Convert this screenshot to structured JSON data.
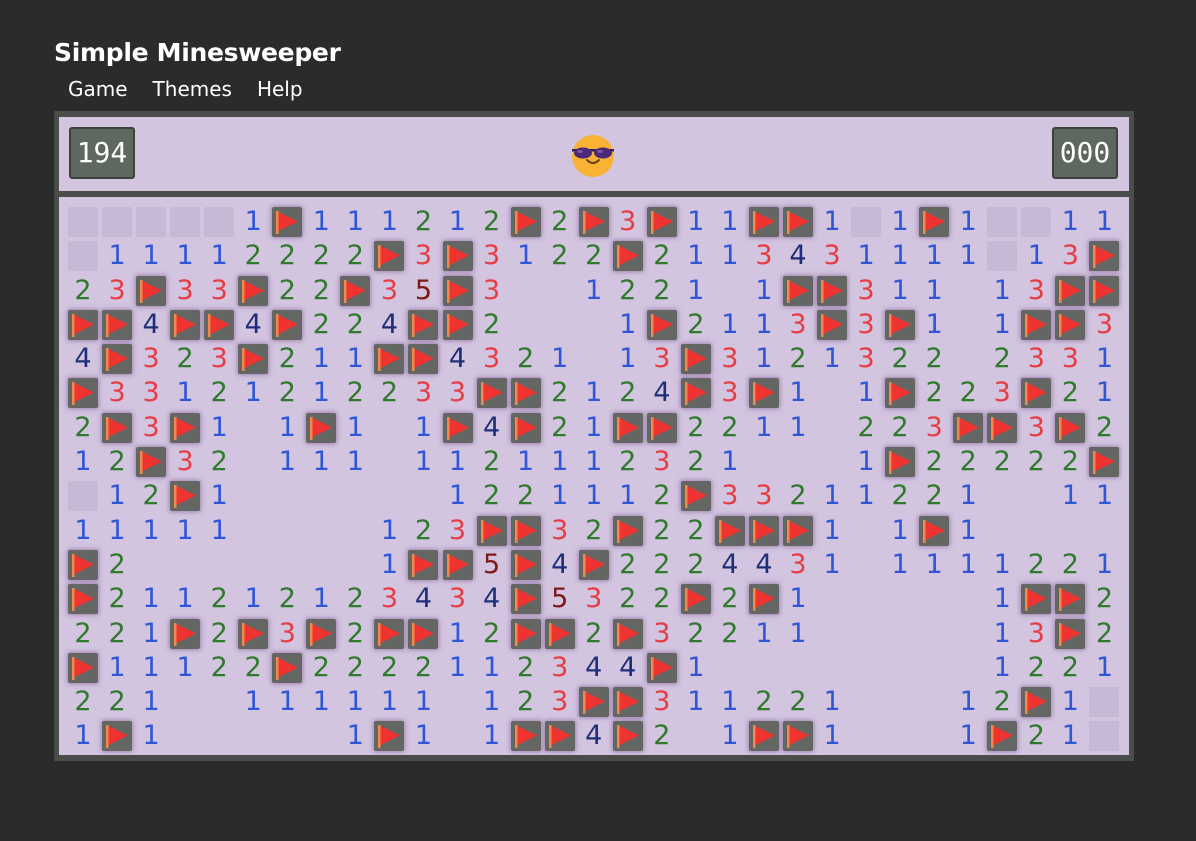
{
  "app": {
    "title": "Simple Minesweeper"
  },
  "menu": {
    "items": [
      "Game",
      "Themes",
      "Help"
    ]
  },
  "header": {
    "mine_counter": "194",
    "timer": "000",
    "face_icon": "cool-sunglasses-face-icon"
  },
  "colors": {
    "background": "#2a2b2a",
    "panel": "#d3c5e0",
    "unopened_cell": "#c7b9d6",
    "flag_cell": "#646664",
    "flag_red": "#ee3330",
    "n1": "#2f56d6",
    "n2": "#2f7a2c",
    "n3": "#e63c44",
    "n4": "#1e2f78",
    "n5": "#7c1a15"
  },
  "board": {
    "columns": 31,
    "legend": "H = hidden, F = flagged, 0 = opened blank, 1-5 = adjacent mine count",
    "rows": [
      [
        "H",
        "H",
        "H",
        "H",
        "H",
        "1",
        "F",
        "1",
        "1",
        "1",
        "2",
        "1",
        "2",
        "F",
        "2",
        "F",
        "3",
        "F",
        "1",
        "1",
        "F",
        "F",
        "1",
        "H",
        "1",
        "F",
        "1",
        "H",
        "H",
        "1",
        "1"
      ],
      [
        "H",
        "1",
        "1",
        "1",
        "1",
        "2",
        "2",
        "2",
        "2",
        "F",
        "3",
        "F",
        "3",
        "1",
        "2",
        "2",
        "F",
        "2",
        "1",
        "1",
        "3",
        "4",
        "3",
        "1",
        "1",
        "1",
        "1",
        "H",
        "1",
        "3",
        "F"
      ],
      [
        "2",
        "3",
        "F",
        "3",
        "3",
        "F",
        "2",
        "2",
        "F",
        "3",
        "5",
        "F",
        "3",
        "0",
        "0",
        "1",
        "2",
        "2",
        "1",
        "0",
        "1",
        "F",
        "F",
        "3",
        "1",
        "1",
        "0",
        "1",
        "3",
        "F",
        "F"
      ],
      [
        "F",
        "F",
        "4",
        "F",
        "F",
        "4",
        "F",
        "2",
        "2",
        "4",
        "F",
        "F",
        "2",
        "0",
        "0",
        "0",
        "1",
        "F",
        "2",
        "1",
        "1",
        "3",
        "F",
        "3",
        "F",
        "1",
        "0",
        "1",
        "F",
        "F",
        "3"
      ],
      [
        "4",
        "F",
        "3",
        "2",
        "3",
        "F",
        "2",
        "1",
        "1",
        "F",
        "F",
        "4",
        "3",
        "2",
        "1",
        "0",
        "1",
        "3",
        "F",
        "3",
        "1",
        "2",
        "1",
        "3",
        "2",
        "2",
        "0",
        "2",
        "3",
        "3",
        "1"
      ],
      [
        "F",
        "3",
        "3",
        "1",
        "2",
        "1",
        "2",
        "1",
        "2",
        "2",
        "3",
        "3",
        "F",
        "F",
        "2",
        "1",
        "2",
        "4",
        "F",
        "3",
        "F",
        "1",
        "0",
        "1",
        "F",
        "2",
        "2",
        "3",
        "F",
        "2",
        "1"
      ],
      [
        "2",
        "F",
        "3",
        "F",
        "1",
        "0",
        "1",
        "F",
        "1",
        "0",
        "1",
        "F",
        "4",
        "F",
        "2",
        "1",
        "F",
        "F",
        "2",
        "2",
        "1",
        "1",
        "0",
        "2",
        "2",
        "3",
        "F",
        "F",
        "3",
        "F",
        "2"
      ],
      [
        "1",
        "2",
        "F",
        "3",
        "2",
        "0",
        "1",
        "1",
        "1",
        "0",
        "1",
        "1",
        "2",
        "1",
        "1",
        "1",
        "2",
        "3",
        "2",
        "1",
        "0",
        "0",
        "0",
        "1",
        "F",
        "2",
        "2",
        "2",
        "2",
        "2",
        "F"
      ],
      [
        "H",
        "1",
        "2",
        "F",
        "1",
        "0",
        "0",
        "0",
        "0",
        "0",
        "0",
        "1",
        "2",
        "2",
        "1",
        "1",
        "1",
        "2",
        "F",
        "3",
        "3",
        "2",
        "1",
        "1",
        "2",
        "2",
        "1",
        "0",
        "0",
        "1",
        "1"
      ],
      [
        "1",
        "1",
        "1",
        "1",
        "1",
        "0",
        "0",
        "0",
        "0",
        "1",
        "2",
        "3",
        "F",
        "F",
        "3",
        "2",
        "F",
        "2",
        "2",
        "F",
        "F",
        "F",
        "1",
        "0",
        "1",
        "F",
        "1",
        "0",
        "0",
        "0",
        "0"
      ],
      [
        "F",
        "2",
        "0",
        "0",
        "0",
        "0",
        "0",
        "0",
        "0",
        "1",
        "F",
        "F",
        "5",
        "F",
        "4",
        "F",
        "2",
        "2",
        "2",
        "4",
        "4",
        "3",
        "1",
        "0",
        "1",
        "1",
        "1",
        "1",
        "2",
        "2",
        "1"
      ],
      [
        "F",
        "2",
        "1",
        "1",
        "2",
        "1",
        "2",
        "1",
        "2",
        "3",
        "4",
        "3",
        "4",
        "F",
        "5",
        "3",
        "2",
        "2",
        "F",
        "2",
        "F",
        "1",
        "0",
        "0",
        "0",
        "0",
        "0",
        "1",
        "F",
        "F",
        "2"
      ],
      [
        "2",
        "2",
        "1",
        "F",
        "2",
        "F",
        "3",
        "F",
        "2",
        "F",
        "F",
        "1",
        "2",
        "F",
        "F",
        "2",
        "F",
        "3",
        "2",
        "2",
        "1",
        "1",
        "0",
        "0",
        "0",
        "0",
        "0",
        "1",
        "3",
        "F",
        "2"
      ],
      [
        "F",
        "1",
        "1",
        "1",
        "2",
        "2",
        "F",
        "2",
        "2",
        "2",
        "2",
        "1",
        "1",
        "2",
        "3",
        "4",
        "4",
        "F",
        "1",
        "0",
        "0",
        "0",
        "0",
        "0",
        "0",
        "0",
        "0",
        "1",
        "2",
        "2",
        "1"
      ],
      [
        "2",
        "2",
        "1",
        "0",
        "0",
        "1",
        "1",
        "1",
        "1",
        "1",
        "1",
        "0",
        "1",
        "2",
        "3",
        "F",
        "F",
        "3",
        "1",
        "1",
        "2",
        "2",
        "1",
        "0",
        "0",
        "0",
        "1",
        "2",
        "F",
        "1",
        "H"
      ],
      [
        "1",
        "F",
        "1",
        "0",
        "0",
        "0",
        "0",
        "0",
        "1",
        "F",
        "1",
        "0",
        "1",
        "F",
        "F",
        "4",
        "F",
        "2",
        "0",
        "1",
        "F",
        "F",
        "1",
        "0",
        "0",
        "0",
        "1",
        "F",
        "2",
        "1",
        "H"
      ]
    ]
  }
}
